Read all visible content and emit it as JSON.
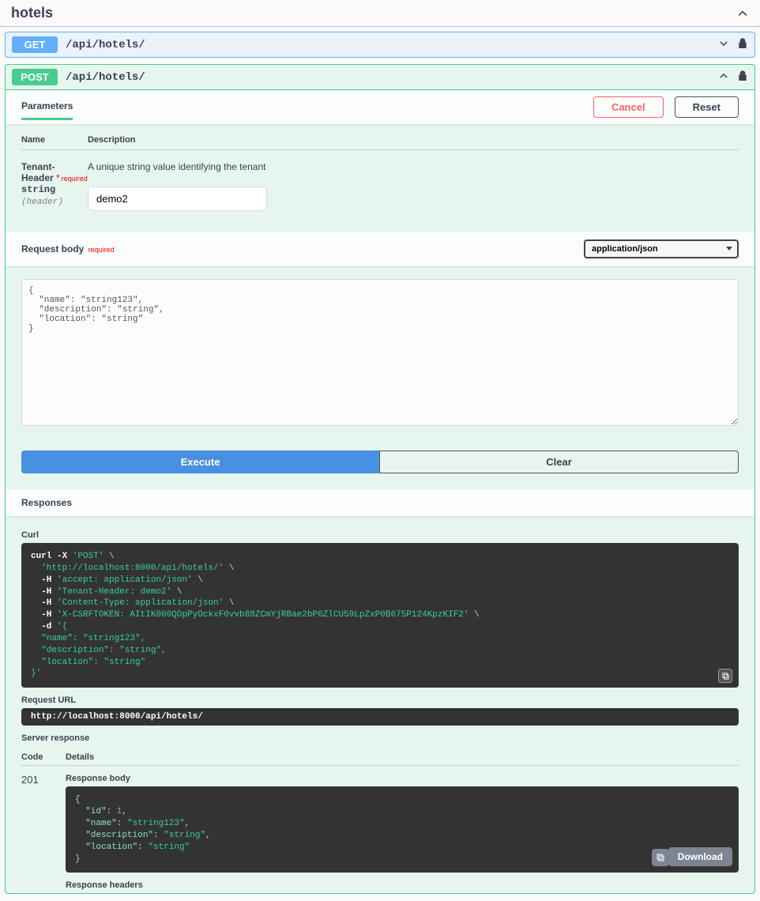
{
  "tag": {
    "name": "hotels"
  },
  "ops": {
    "get": {
      "method": "GET",
      "path": "/api/hotels/"
    },
    "post": {
      "method": "POST",
      "path": "/api/hotels/"
    }
  },
  "params": {
    "tab": "Parameters",
    "cancel": "Cancel",
    "reset": "Reset",
    "col_name": "Name",
    "col_desc": "Description",
    "tenant": {
      "name": "Tenant-Header",
      "required_label": "required",
      "type": "string",
      "in": "(header)",
      "description": "A unique string value identifying the tenant",
      "value": "demo2"
    }
  },
  "body": {
    "title": "Request body",
    "required_label": "required",
    "content_type": "application/json",
    "textarea": "{\n  \"name\": \"string123\",\n  \"description\": \"string\",\n  \"location\": \"string\"\n}"
  },
  "buttons": {
    "execute": "Execute",
    "clear": "Clear"
  },
  "responses": {
    "title": "Responses",
    "curl_label": "Curl",
    "request_url_label": "Request URL",
    "request_url": "http://localhost:8000/api/hotels/",
    "server_response_label": "Server response",
    "col_code": "Code",
    "col_details": "Details",
    "code": "201",
    "response_body_label": "Response body",
    "response_headers_label": "Response headers",
    "download": "Download"
  },
  "curl": {
    "l1a": "curl -X ",
    "l1b": "'POST'",
    "l2": "'http://localhost:8000/api/hotels/'",
    "l3p": "-H ",
    "l3": "'accept: application/json'",
    "l4": "'Tenant-Header: demo2'",
    "l5": "'Content-Type: application/json'",
    "l6": "'X-CSRFTOKEN: AItIK000QDpPyOckxF0vvb88ZCmYjRBae2bP6ZlCU59LpZxP0B675P124KpzKIF2'",
    "dflag": "-d ",
    "l7": "'{",
    "l8": "  \"name\": \"string123\",",
    "l9": "  \"description\": \"string\",",
    "l10": "  \"location\": \"string\"",
    "l11": "}'"
  },
  "chart_data": {
    "type": "table",
    "response_body": {
      "id": 1,
      "name": "string123",
      "description": "string",
      "location": "string"
    }
  }
}
